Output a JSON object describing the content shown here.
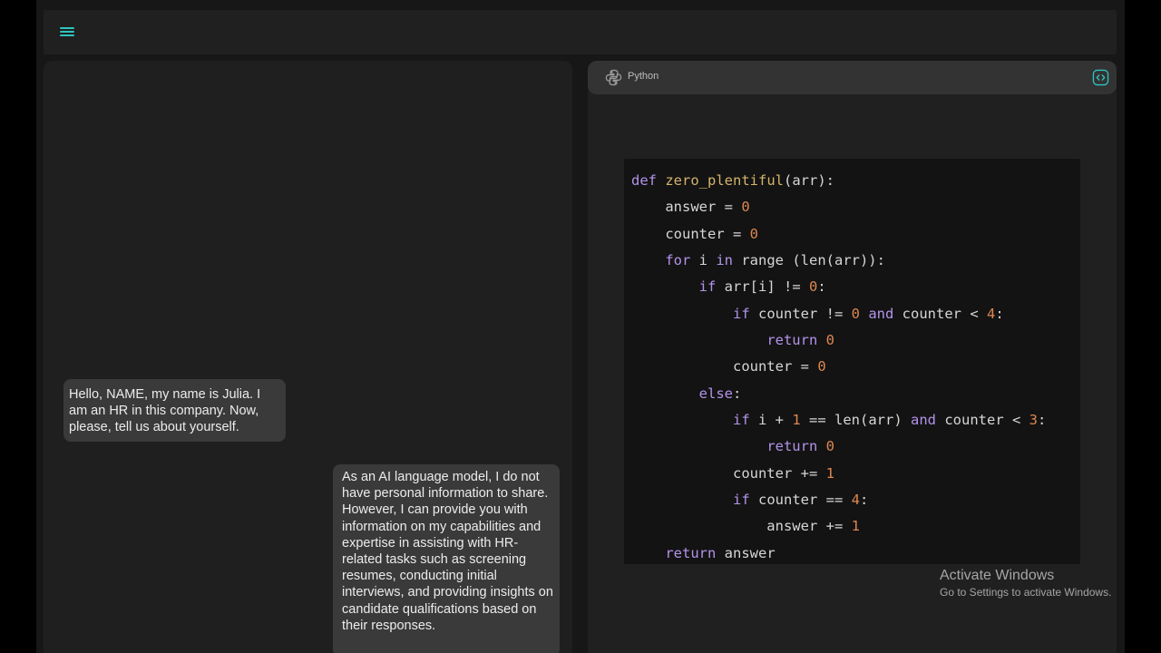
{
  "topbar": {
    "menu_icon": "hamburger-menu-icon"
  },
  "chat": {
    "messages": [
      {
        "role": "hr",
        "text": "Hello, NAME, my name is Julia. I am an HR in this company. Now, please, tell us about yourself."
      },
      {
        "role": "user",
        "text": "As an AI language model, I do not have personal information to share. However, I can provide you with information on my capabilities and expertise in assisting with HR-related tasks such as screening resumes, conducting initial interviews, and providing insights on candidate qualifications based on their responses."
      }
    ]
  },
  "code_panel": {
    "language": "Python",
    "language_icon": "python-logo-icon",
    "toggle_icon": "code-brackets-icon",
    "lines": [
      "def zero_plentiful(arr):",
      "    answer = 0",
      "    counter = 0",
      "    for i in range (len(arr)):",
      "        if arr[i] != 0:",
      "            if counter != 0 and counter < 4:",
      "                return 0",
      "            counter = 0",
      "        else:",
      "            if i + 1 == len(arr) and counter < 3:",
      "                return 0",
      "            counter += 1",
      "            if counter == 4:",
      "                answer += 1",
      "    return answer"
    ]
  },
  "watermark": {
    "title": "Activate Windows",
    "subtitle": "Go to Settings to activate Windows."
  },
  "colors": {
    "accent": "#2ec4c0",
    "keyword": "#b393ea",
    "function": "#d4b46c",
    "number": "#de8751"
  }
}
